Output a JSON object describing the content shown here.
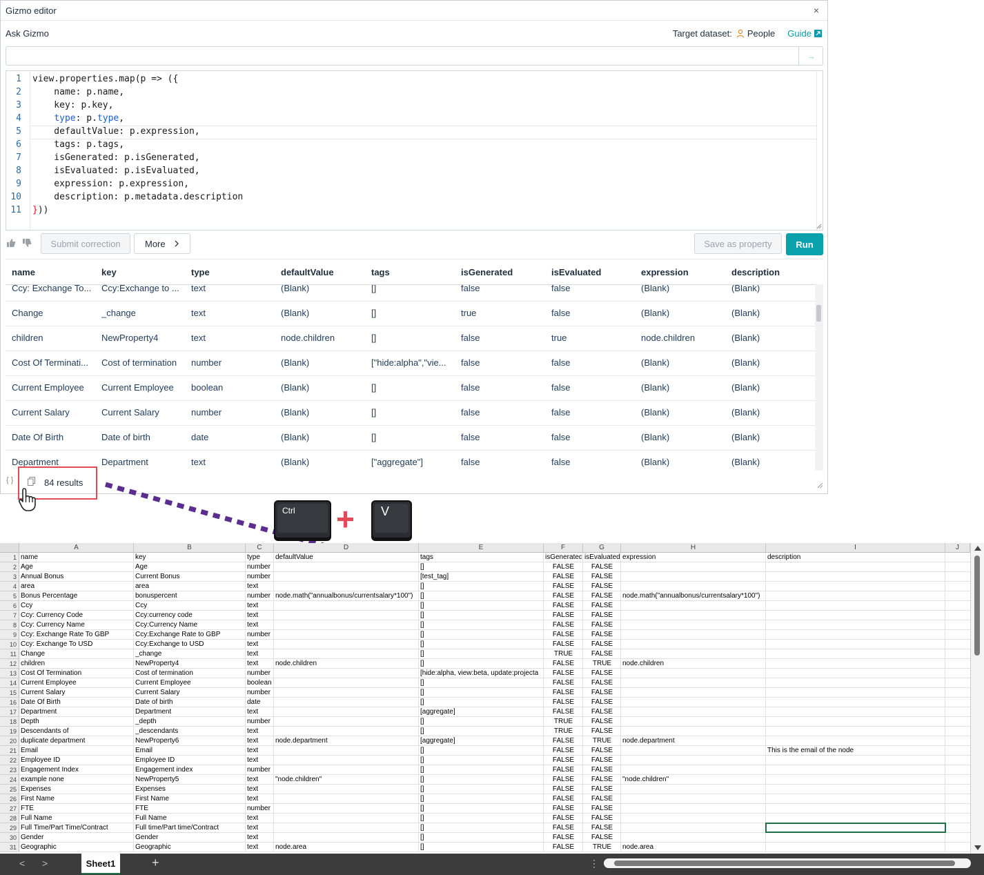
{
  "editor": {
    "title": "Gizmo editor",
    "close_glyph": "×",
    "ask_label": "Ask Gizmo",
    "target_label": "Target dataset:",
    "target_dataset": "People",
    "guide_label": "Guide",
    "send_glyph": "→",
    "code_lines": [
      "view.properties.map(p => ({",
      "    name: p.name,",
      "    key: p.key,",
      "    type: p.type,",
      "    defaultValue: p.expression,",
      "    tags: p.tags,",
      "    isGenerated: p.isGenerated,",
      "    isEvaluated: p.isEvaluated,",
      "    expression: p.expression,",
      "    description: p.metadata.description",
      "}))"
    ],
    "line_numbers": [
      "1",
      "2",
      "3",
      "4",
      "5",
      "6",
      "7",
      "8",
      "9",
      "10",
      "11"
    ],
    "buttons": {
      "submit_correction": "Submit correction",
      "more": "More",
      "save_as_property": "Save as property",
      "run": "Run"
    },
    "columns": [
      "name",
      "key",
      "type",
      "defaultValue",
      "tags",
      "isGenerated",
      "isEvaluated",
      "expression",
      "description"
    ],
    "rows": [
      [
        "Ccy: Exchange To...",
        "Ccy:Exchange to ...",
        "text",
        "(Blank)",
        "[]",
        "false",
        "false",
        "(Blank)",
        "(Blank)"
      ],
      [
        "Change",
        "_change",
        "text",
        "(Blank)",
        "[]",
        "true",
        "false",
        "(Blank)",
        "(Blank)"
      ],
      [
        "children",
        "NewProperty4",
        "text",
        "node.children",
        "[]",
        "false",
        "true",
        "node.children",
        "(Blank)"
      ],
      [
        "Cost Of Terminati...",
        "Cost of termination",
        "number",
        "(Blank)",
        "[\"hide:alpha\",\"vie...",
        "false",
        "false",
        "(Blank)",
        "(Blank)"
      ],
      [
        "Current Employee",
        "Current Employee",
        "boolean",
        "(Blank)",
        "[]",
        "false",
        "false",
        "(Blank)",
        "(Blank)"
      ],
      [
        "Current Salary",
        "Current Salary",
        "number",
        "(Blank)",
        "[]",
        "false",
        "false",
        "(Blank)",
        "(Blank)"
      ],
      [
        "Date Of Birth",
        "Date of birth",
        "date",
        "(Blank)",
        "[]",
        "false",
        "false",
        "(Blank)",
        "(Blank)"
      ],
      [
        "Department",
        "Department",
        "text",
        "(Blank)",
        "[\"aggregate\"]",
        "false",
        "false",
        "(Blank)",
        "(Blank)"
      ]
    ],
    "results_label": "84 results",
    "braces_glyph": "{ }"
  },
  "keys": {
    "ctrl": "Ctrl",
    "plus": "+",
    "v": "V"
  },
  "sheet": {
    "col_letters": [
      "A",
      "B",
      "C",
      "D",
      "E",
      "F",
      "G",
      "H",
      "I",
      "J"
    ],
    "rows": [
      [
        "name",
        "key",
        "type",
        "defaultValue",
        "tags",
        "isGenerated",
        "isEvaluated",
        "expression",
        "description"
      ],
      [
        "Age",
        "Age",
        "number",
        "",
        "[]",
        "FALSE",
        "FALSE",
        "",
        ""
      ],
      [
        "Annual Bonus",
        "Current Bonus",
        "number",
        "",
        "[test_tag]",
        "FALSE",
        "FALSE",
        "",
        ""
      ],
      [
        "area",
        "area",
        "text",
        "",
        "[]",
        "FALSE",
        "FALSE",
        "",
        ""
      ],
      [
        "Bonus Percentage",
        "bonuspercent",
        "number",
        "node.math(\"annualbonus/currentsalary*100\")",
        "[]",
        "FALSE",
        "FALSE",
        "node.math(\"annualbonus/currentsalary*100\")",
        ""
      ],
      [
        "Ccy",
        "Ccy",
        "text",
        "",
        "[]",
        "FALSE",
        "FALSE",
        "",
        ""
      ],
      [
        "Ccy: Currency Code",
        "Ccy:currency code",
        "text",
        "",
        "[]",
        "FALSE",
        "FALSE",
        "",
        ""
      ],
      [
        "Ccy: Currency Name",
        "Ccy:Currency Name",
        "text",
        "",
        "[]",
        "FALSE",
        "FALSE",
        "",
        ""
      ],
      [
        "Ccy: Exchange Rate To GBP",
        "Ccy:Exchange Rate to GBP",
        "number",
        "",
        "[]",
        "FALSE",
        "FALSE",
        "",
        ""
      ],
      [
        "Ccy: Exchange To USD",
        "Ccy:Exchange to USD",
        "text",
        "",
        "[]",
        "FALSE",
        "FALSE",
        "",
        ""
      ],
      [
        "Change",
        "_change",
        "text",
        "",
        "[]",
        "TRUE",
        "FALSE",
        "",
        ""
      ],
      [
        "children",
        "NewProperty4",
        "text",
        "node.children",
        "[]",
        "FALSE",
        "TRUE",
        "node.children",
        ""
      ],
      [
        "Cost Of Termination",
        "Cost of termination",
        "number",
        "",
        "[hide:alpha, view:beta, update:projecta",
        "FALSE",
        "FALSE",
        "",
        ""
      ],
      [
        "Current Employee",
        "Current Employee",
        "boolean",
        "",
        "[]",
        "FALSE",
        "FALSE",
        "",
        ""
      ],
      [
        "Current Salary",
        "Current Salary",
        "number",
        "",
        "[]",
        "FALSE",
        "FALSE",
        "",
        ""
      ],
      [
        "Date Of Birth",
        "Date of birth",
        "date",
        "",
        "[]",
        "FALSE",
        "FALSE",
        "",
        ""
      ],
      [
        "Department",
        "Department",
        "text",
        "",
        "[aggregate]",
        "FALSE",
        "FALSE",
        "",
        ""
      ],
      [
        "Depth",
        "_depth",
        "number",
        "",
        "[]",
        "TRUE",
        "FALSE",
        "",
        ""
      ],
      [
        "Descendants of",
        "_descendants",
        "text",
        "",
        "[]",
        "TRUE",
        "FALSE",
        "",
        ""
      ],
      [
        "duplicate department",
        "NewProperty6",
        "text",
        "node.department",
        "[aggregate]",
        "FALSE",
        "TRUE",
        "node.department",
        ""
      ],
      [
        "Email",
        "Email",
        "text",
        "",
        "[]",
        "FALSE",
        "FALSE",
        "",
        "This is the email of the node"
      ],
      [
        "Employee ID",
        "Employee ID",
        "text",
        "",
        "[]",
        "FALSE",
        "FALSE",
        "",
        ""
      ],
      [
        "Engagement Index",
        "Engagement index",
        "number",
        "",
        "[]",
        "FALSE",
        "FALSE",
        "",
        ""
      ],
      [
        "example none",
        "NewProperty5",
        "text",
        "\"node.children\"",
        "[]",
        "FALSE",
        "FALSE",
        "\"node.children\"",
        ""
      ],
      [
        "Expenses",
        "Expenses",
        "text",
        "",
        "[]",
        "FALSE",
        "FALSE",
        "",
        ""
      ],
      [
        "First Name",
        "First Name",
        "text",
        "",
        "[]",
        "FALSE",
        "FALSE",
        "",
        ""
      ],
      [
        "FTE",
        "FTE",
        "number",
        "",
        "[]",
        "FALSE",
        "FALSE",
        "",
        ""
      ],
      [
        "Full Name",
        "Full Name",
        "text",
        "",
        "[]",
        "FALSE",
        "FALSE",
        "",
        ""
      ],
      [
        "Full Time/Part Time/Contract",
        "Full time/Part time/Contract",
        "text",
        "",
        "[]",
        "FALSE",
        "FALSE",
        "",
        ""
      ],
      [
        "Gender",
        "Gender",
        "text",
        "",
        "[]",
        "FALSE",
        "FALSE",
        "",
        ""
      ],
      [
        "Geographic",
        "Geographic",
        "text",
        "node.area",
        "[]",
        "FALSE",
        "TRUE",
        "node.area",
        ""
      ]
    ],
    "tab_name": "Sheet1",
    "add_glyph": "+",
    "prev_glyph": "<",
    "next_glyph": ">",
    "more_glyph": "⋮"
  }
}
